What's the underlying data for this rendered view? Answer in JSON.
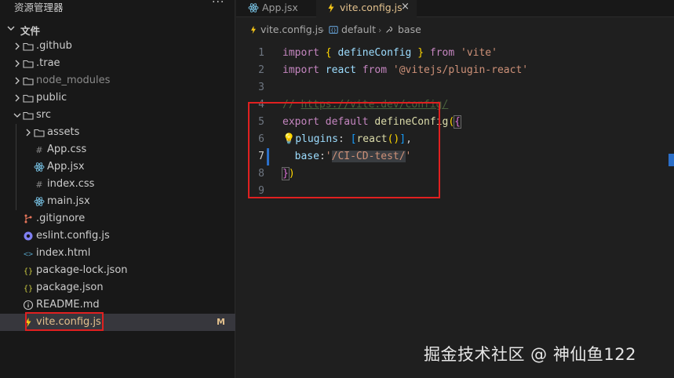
{
  "explorer": {
    "title": "资源管理器",
    "more": "···",
    "section": "文件",
    "items": [
      {
        "name": ".github",
        "type": "folder",
        "depth": 0,
        "expanded": false
      },
      {
        "name": ".trae",
        "type": "folder",
        "depth": 0,
        "expanded": false
      },
      {
        "name": "node_modules",
        "type": "folder",
        "depth": 0,
        "expanded": false
      },
      {
        "name": "public",
        "type": "folder",
        "depth": 0,
        "expanded": false
      },
      {
        "name": "src",
        "type": "folder",
        "depth": 0,
        "expanded": true
      },
      {
        "name": "assets",
        "type": "folder",
        "depth": 1,
        "expanded": false
      },
      {
        "name": "App.css",
        "type": "css",
        "depth": 1
      },
      {
        "name": "App.jsx",
        "type": "react",
        "depth": 1
      },
      {
        "name": "index.css",
        "type": "css",
        "depth": 1
      },
      {
        "name": "main.jsx",
        "type": "react",
        "depth": 1
      },
      {
        "name": ".gitignore",
        "type": "git",
        "depth": 0
      },
      {
        "name": "eslint.config.js",
        "type": "eslint",
        "depth": 0
      },
      {
        "name": "index.html",
        "type": "html",
        "depth": 0
      },
      {
        "name": "package-lock.json",
        "type": "json",
        "depth": 0
      },
      {
        "name": "package.json",
        "type": "json",
        "depth": 0
      },
      {
        "name": "README.md",
        "type": "info",
        "depth": 0
      },
      {
        "name": "vite.config.js",
        "type": "vite",
        "depth": 0,
        "badge": "M",
        "selected": true
      }
    ]
  },
  "tabs": [
    {
      "label": "App.jsx",
      "icon": "react-icon",
      "active": false
    },
    {
      "label": "vite.config.js",
      "icon": "vite-icon",
      "active": true,
      "close": "×"
    }
  ],
  "breadcrumb": {
    "file": "vite.config.js",
    "symbol1": "default",
    "symbol2": "base",
    "separator": "›"
  },
  "code": {
    "line_numbers": [
      "1",
      "2",
      "3",
      "4",
      "5",
      "6",
      "7",
      "8",
      "9"
    ],
    "current_line": "7"
  },
  "watermark": "掘金技术社区 @ 神仙鱼122",
  "colors": {
    "background": "#1f1f1f",
    "sidebar": "#181818",
    "modified": "#e2c08d",
    "highlight_box": "#e02020"
  }
}
